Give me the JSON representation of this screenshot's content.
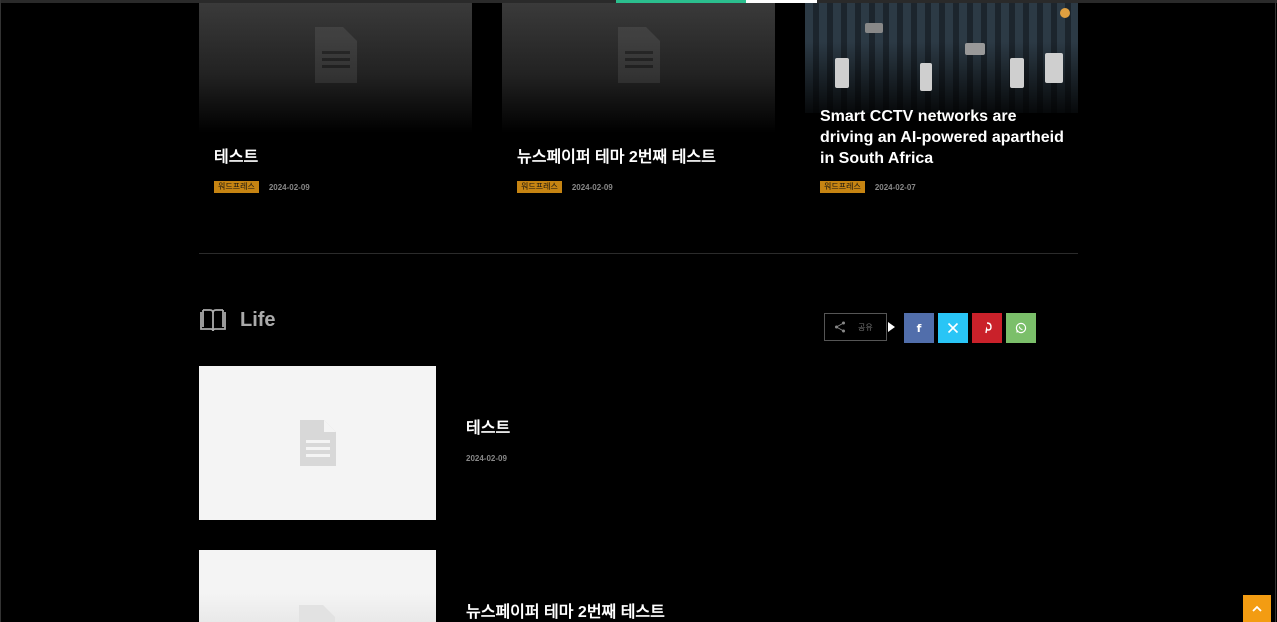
{
  "top_cards": [
    {
      "title": "테스트",
      "category": "워드프레스",
      "date": "2024-02-09"
    },
    {
      "title": "뉴스페이퍼 테마 2번째 테스트",
      "category": "워드프레스",
      "date": "2024-02-09"
    },
    {
      "title": "Smart CCTV networks are driving an AI-powered apartheid in South Africa",
      "category": "워드프레스",
      "date": "2024-02-07"
    }
  ],
  "life_section": {
    "title": "Life",
    "items": [
      {
        "title": "테스트",
        "date": "2024-02-09"
      },
      {
        "title": "뉴스페이퍼 테마 2번째 테스트",
        "date": ""
      }
    ]
  },
  "share": {
    "label": "공유",
    "buttons": [
      {
        "name": "facebook",
        "color": "#516eab",
        "icon": "f"
      },
      {
        "name": "twitter",
        "color": "#29c5f6",
        "icon": "x-icon"
      },
      {
        "name": "pinterest",
        "color": "#ca212a",
        "icon": "pinterest-icon"
      },
      {
        "name": "whatsapp",
        "color": "#7bbf6a",
        "icon": "whatsapp-icon"
      }
    ]
  },
  "colors": {
    "accent_badge": "#c68412",
    "back_to_top": "#f39c12",
    "progress_green": "#2bbf8e"
  }
}
